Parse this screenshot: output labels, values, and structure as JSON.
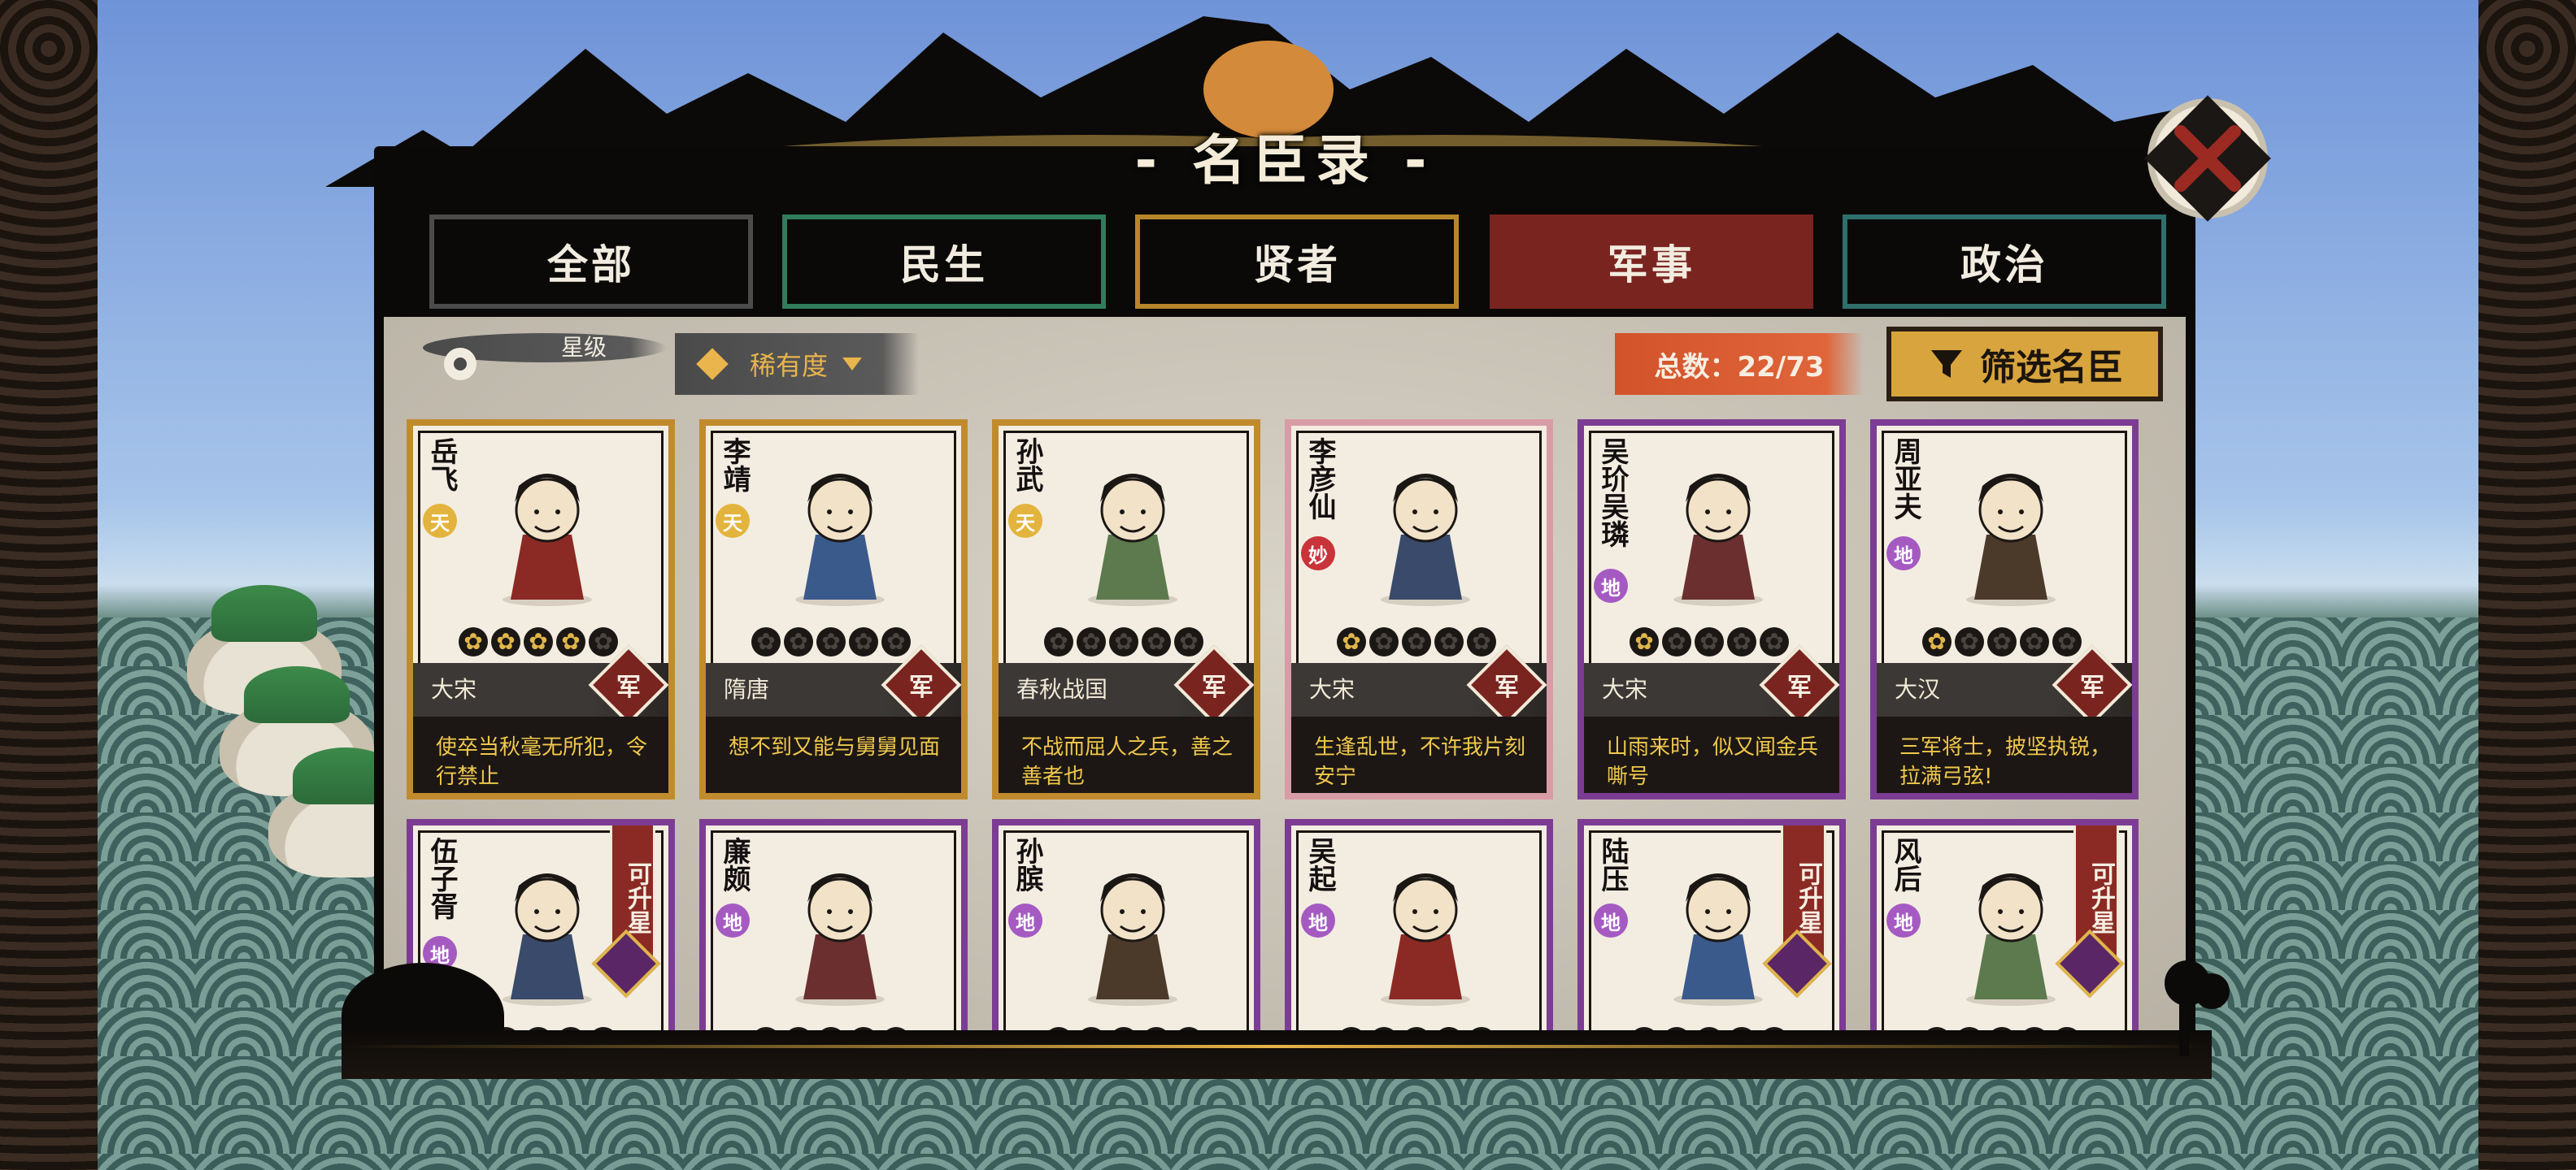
{
  "title": "- 名臣录 -",
  "tabs": [
    {
      "label": "全部"
    },
    {
      "label": "民生"
    },
    {
      "label": "贤者"
    },
    {
      "label": "军事"
    },
    {
      "label": "政治"
    }
  ],
  "active_tab": "军事",
  "filters": {
    "star_label": "星级",
    "rarity_label": "稀有度"
  },
  "total_label": "总数：22/73",
  "filter_button_label": "筛选名臣",
  "cards_row1": [
    {
      "name": "岳飞",
      "grade": "天",
      "stars_on": 4,
      "era": "大宋",
      "type": "军",
      "quote": "使卒当秋毫无所犯，令行禁止",
      "frame": "gold"
    },
    {
      "name": "李靖",
      "grade": "天",
      "stars_on": 0,
      "era": "隋唐",
      "type": "军",
      "quote": "想不到又能与舅舅见面",
      "frame": "gold"
    },
    {
      "name": "孙武",
      "grade": "天",
      "stars_on": 0,
      "era": "春秋战国",
      "type": "军",
      "quote": "不战而屈人之兵，善之善者也",
      "frame": "gold"
    },
    {
      "name": "李彦仙",
      "grade": "妙",
      "stars_on": 1,
      "era": "大宋",
      "type": "军",
      "quote": "生逢乱世，不许我片刻安宁",
      "frame": "pink"
    },
    {
      "name": "吴玠吴璘",
      "grade": "地",
      "stars_on": 1,
      "era": "大宋",
      "type": "军",
      "quote": "山雨来时，似又闻金兵嘶号",
      "frame": "purple"
    },
    {
      "name": "周亚夫",
      "grade": "地",
      "stars_on": 1,
      "era": "大汉",
      "type": "军",
      "quote": "三军将士，披坚执锐，拉满弓弦!",
      "frame": "purple"
    }
  ],
  "cards_row2": [
    {
      "name": "伍子胥",
      "grade": "地",
      "upgrade": "可升星",
      "frame": "purple"
    },
    {
      "name": "廉颇",
      "grade": "地",
      "upgrade": "",
      "frame": "purple"
    },
    {
      "name": "孙膑",
      "grade": "地",
      "upgrade": "",
      "frame": "purple"
    },
    {
      "name": "吴起",
      "grade": "地",
      "upgrade": "",
      "frame": "purple"
    },
    {
      "name": "陆压",
      "grade": "地",
      "upgrade": "可升星",
      "frame": "purple"
    },
    {
      "name": "风后",
      "grade": "地",
      "upgrade": "可升星",
      "frame": "purple"
    }
  ],
  "colors": {
    "active_tab": "#7a2420",
    "gold_frame": "#c18b2d",
    "purple_frame": "#7c3c93",
    "pink_frame": "#d89ca6",
    "quote_text": "#f0c84c"
  },
  "icons": [
    "close-icon",
    "flower-star-icon",
    "diamond-icon",
    "filter-funnel-icon",
    "star-icon",
    "military-badge-icon"
  ]
}
